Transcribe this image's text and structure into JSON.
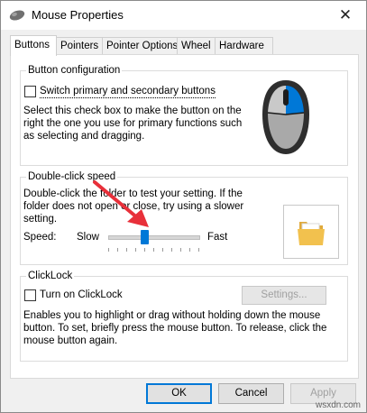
{
  "window": {
    "title": "Mouse Properties",
    "close_glyph": "✕"
  },
  "tabs": [
    {
      "label": "Buttons",
      "active": true
    },
    {
      "label": "Pointers",
      "active": false
    },
    {
      "label": "Pointer Options",
      "active": false
    },
    {
      "label": "Wheel",
      "active": false
    },
    {
      "label": "Hardware",
      "active": false
    }
  ],
  "button_config": {
    "title": "Button configuration",
    "switch_label": "Switch primary and secondary buttons",
    "switch_checked": false,
    "description_lines": [
      "Select this check box to make the button on the",
      "right the one you use for primary functions such",
      "as selecting and dragging."
    ],
    "icon": "mouse-icon"
  },
  "double_click": {
    "title": "Double-click speed",
    "description_lines": [
      "Double-click the folder to test your setting. If the",
      "folder does not open or close, try using a slower",
      "setting."
    ],
    "speed_label": "Speed:",
    "slow_label": "Slow",
    "fast_label": "Fast",
    "speed_value": 0.4,
    "folder_icon": "folder-icon",
    "annotation": "red-arrow-icon"
  },
  "clicklock": {
    "title": "ClickLock",
    "turn_on_label": "Turn on ClickLock",
    "turn_on_checked": false,
    "settings_label": "Settings...",
    "description_lines": [
      "Enables you to highlight or drag without holding down the mouse",
      "button. To set, briefly press the mouse button. To release, click the",
      "mouse button again."
    ]
  },
  "footer": {
    "ok_label": "OK",
    "cancel_label": "Cancel",
    "apply_label": "Apply"
  },
  "watermark": "wsxdn.com",
  "colors": {
    "accent": "#0078d7",
    "arrow": "#e8303a",
    "folder": "#f2c14e"
  }
}
